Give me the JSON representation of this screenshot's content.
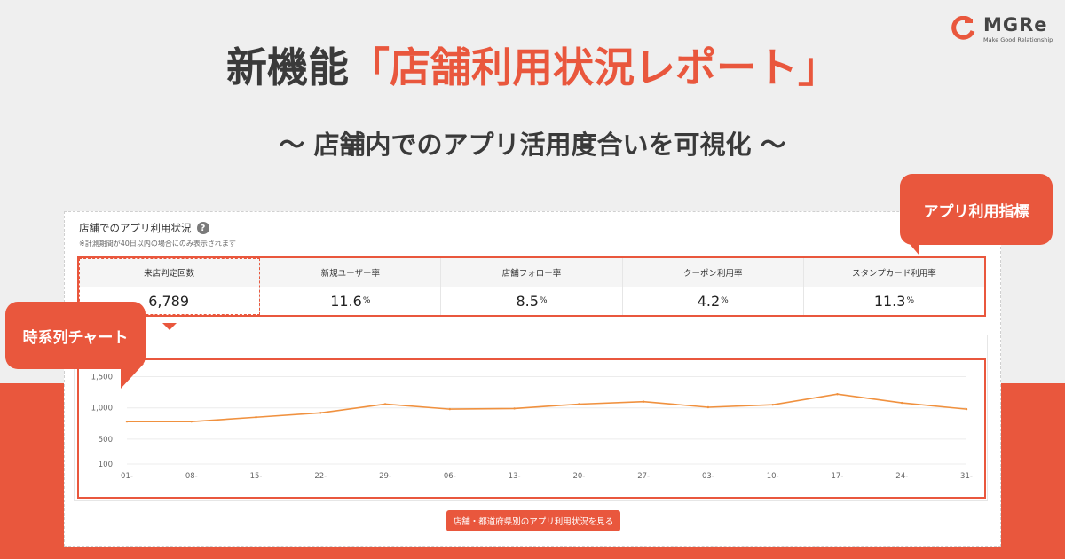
{
  "logo": {
    "name": "MGRe",
    "tagline": "Make Good Relationship",
    "icon": "mgre-logo-icon"
  },
  "headline": {
    "part1": "新機能",
    "part2": "「店舗利用状況レポート」"
  },
  "subhead": "〜 店舗内でのアプリ活用度合いを可視化 〜",
  "panel": {
    "title": "店舗でのアプリ利用状況",
    "help_icon": "question-icon",
    "help_symbol": "?",
    "note": "※計測期間が40日以内の場合にのみ表示されます"
  },
  "metrics": [
    {
      "label": "来店判定回数",
      "value": "6,789",
      "unit": ""
    },
    {
      "label": "新規ユーザー率",
      "value": "11.6",
      "unit": "%"
    },
    {
      "label": "店舗フォロー率",
      "value": "8.5",
      "unit": "%"
    },
    {
      "label": "クーポン利用率",
      "value": "4.2",
      "unit": "%"
    },
    {
      "label": "スタンプカード利用率",
      "value": "11.3",
      "unit": "%"
    }
  ],
  "callouts": {
    "metrics": "アプリ利用指標",
    "timeseries": "時系列チャート"
  },
  "cta_label": "店舗・都道府県別のアプリ利用状況を見る",
  "colors": {
    "accent": "#e9573d",
    "line": "#f0913f",
    "text": "#3a3a3a"
  },
  "chart_data": {
    "type": "line",
    "title": "",
    "xlabel": "",
    "ylabel": "",
    "x": [
      "01-",
      "08-",
      "15-",
      "22-",
      "29-",
      "06-",
      "13-",
      "20-",
      "27-",
      "03-",
      "10-",
      "17-",
      "24-",
      "31-"
    ],
    "y_ticks": [
      "100",
      "500",
      "1,000",
      "1,500"
    ],
    "y_tick_values": [
      100,
      500,
      1000,
      1500
    ],
    "ylim": [
      100,
      1650
    ],
    "grid": true,
    "series": [
      {
        "values": [
          780,
          780,
          850,
          920,
          1060,
          980,
          990,
          1060,
          1100,
          1010,
          1050,
          1220,
          1080,
          980
        ]
      }
    ]
  }
}
